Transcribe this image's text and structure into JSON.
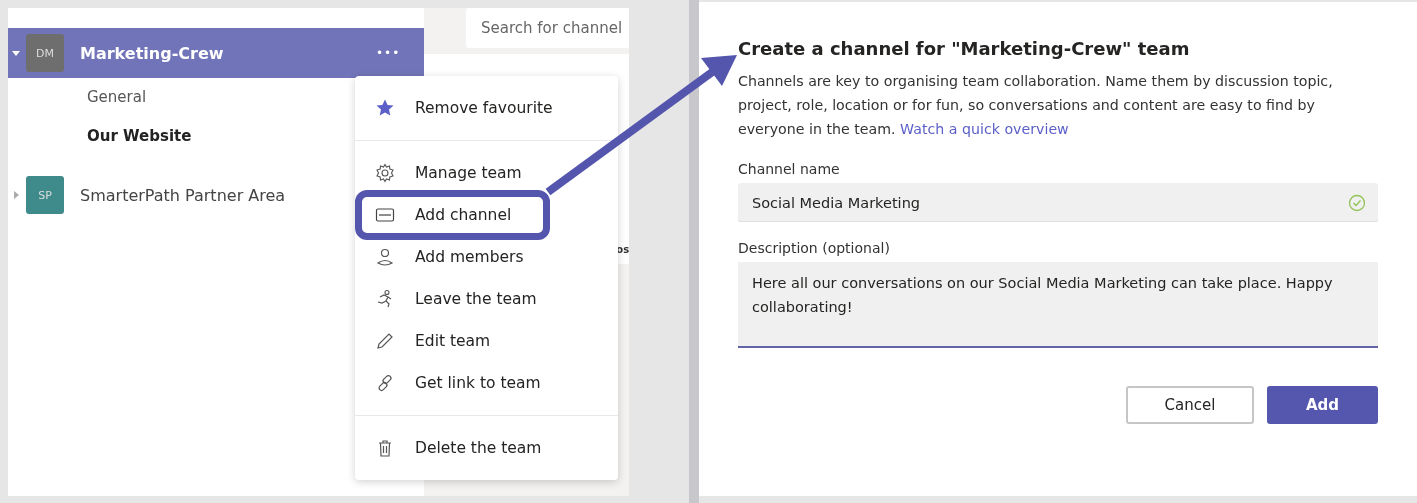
{
  "sidebar": {
    "teams": [
      {
        "initials": "DM",
        "name": "Marketing-Crew",
        "expanded": true,
        "selected": true,
        "color": "#6e6e6e",
        "more": "•••",
        "channels": [
          {
            "name": "General",
            "bold": false
          },
          {
            "name": "Our Website",
            "bold": true
          }
        ]
      },
      {
        "initials": "SP",
        "name": "SmarterPath Partner Area",
        "expanded": false,
        "selected": false,
        "color": "#3f8b8b"
      }
    ]
  },
  "search": {
    "placeholder": "Search for channel"
  },
  "background_text": "os",
  "menu": {
    "groups": [
      [
        {
          "label": "Remove favourite",
          "highlighted": false
        }
      ],
      [
        {
          "label": "Manage team",
          "highlighted": false
        },
        {
          "label": "Add channel",
          "highlighted": true
        },
        {
          "label": "Add members",
          "highlighted": false
        },
        {
          "label": "Leave the team",
          "highlighted": false
        },
        {
          "label": "Edit team",
          "highlighted": false
        },
        {
          "label": "Get link to team",
          "highlighted": false
        }
      ],
      [
        {
          "label": "Delete the team",
          "highlighted": false
        }
      ]
    ]
  },
  "dialog": {
    "title": "Create a channel for \"Marketing-Crew\" team",
    "description": "Channels are key to organising team collaboration. Name them by discussion topic, project, role, location or for fun, so conversations and content are easy to find by everyone in the team.",
    "link": "Watch a quick overview",
    "fields": [
      {
        "kind": "input",
        "label": "Channel name",
        "value": "Social Media Marketing",
        "valid": true
      },
      {
        "kind": "textarea",
        "label": "Description (optional)",
        "value": "Here all our conversations on our Social Media Marketing can take place. Happy collaborating!"
      }
    ],
    "buttons": [
      {
        "label": "Cancel",
        "primary": false
      },
      {
        "label": "Add",
        "primary": true
      }
    ]
  }
}
